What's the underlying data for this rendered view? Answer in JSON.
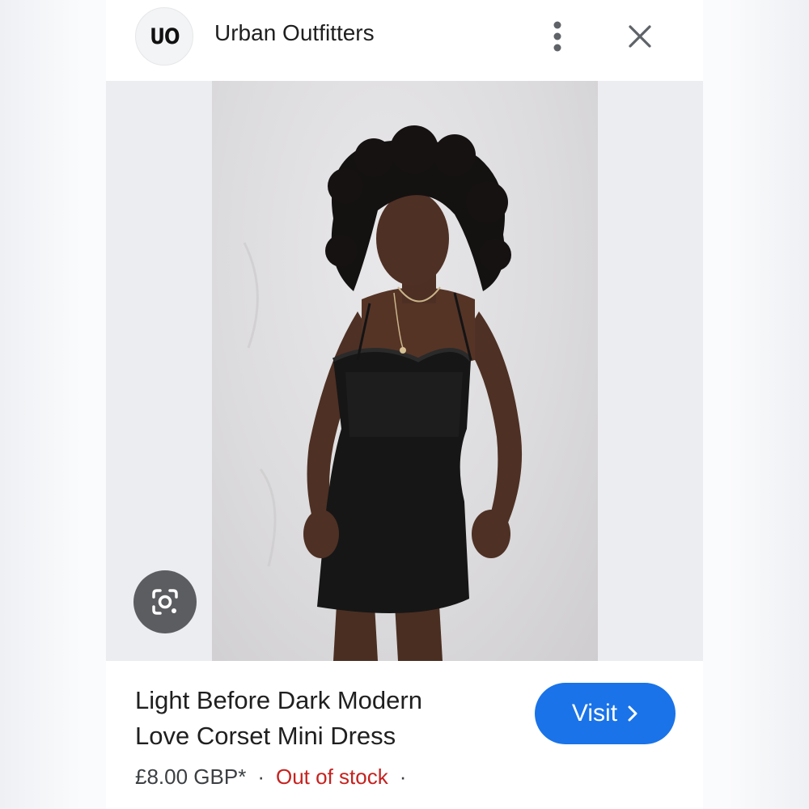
{
  "header": {
    "logo_text": "UO",
    "site_name": "Urban Outfitters",
    "icons": {
      "more": "more-vert-icon",
      "close": "close-icon"
    }
  },
  "image": {
    "alt": "Light Before Dark Modern Love Corset Mini Dress",
    "lens_icon": "google-lens-icon"
  },
  "product": {
    "title_line1": "Light Before Dark Modern",
    "title_line2": "Love Corset Mini Dress",
    "price": "£8.00 GBP*",
    "separator": "·",
    "stock_status": "Out of stock",
    "trailing_separator": "·"
  },
  "visit_button": {
    "label": "Visit",
    "icon": "chevron-right-icon",
    "color": "#1a73e8"
  },
  "colors": {
    "stock_red": "#c5221f",
    "text": "#1f1f1f"
  }
}
